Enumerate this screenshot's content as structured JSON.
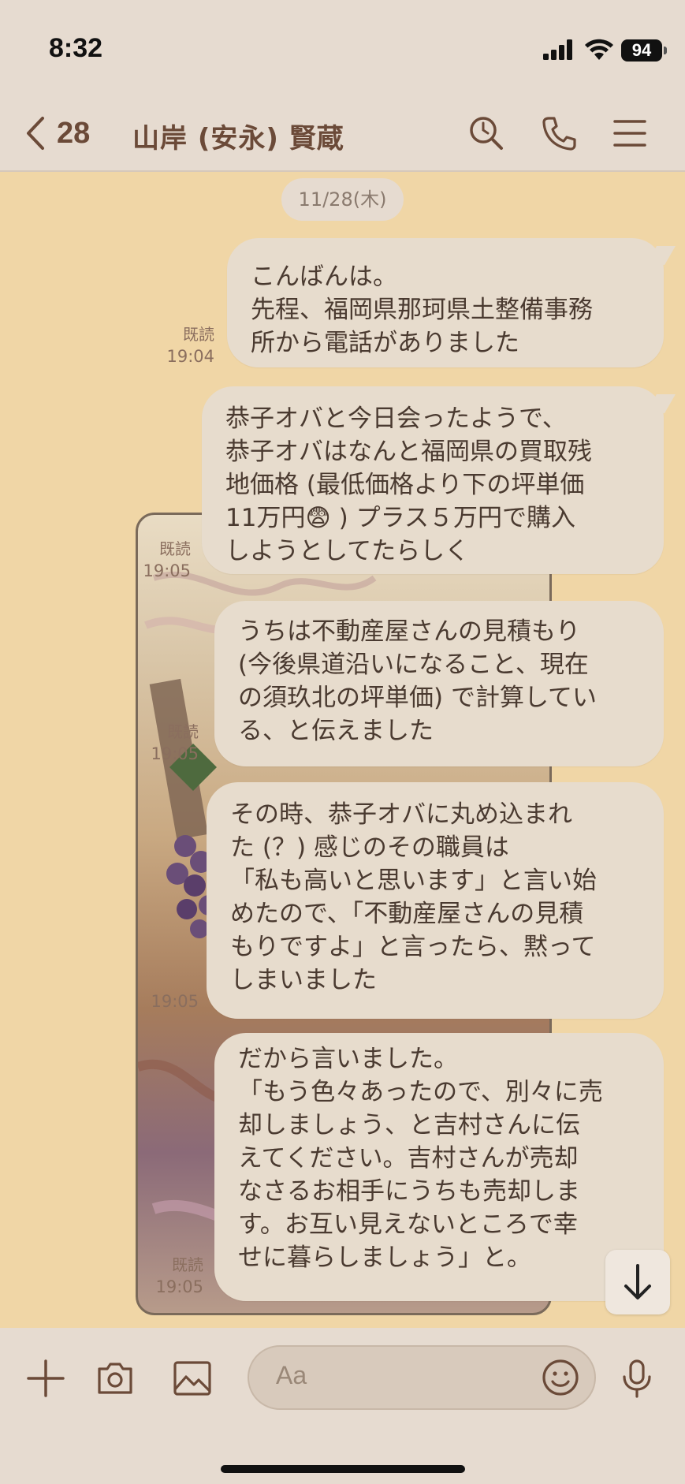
{
  "status_bar": {
    "time": "8:32",
    "battery": "94"
  },
  "header": {
    "back_count": "28",
    "title": "山岸 (安永) 賢蔵",
    "icons": [
      "search-icon",
      "phone-icon",
      "menu-icon"
    ]
  },
  "chat": {
    "date": "11/28(木)",
    "messages": [
      {
        "read": "既読",
        "time": "19:04",
        "lines": [
          "こんばんは。",
          "先程、福岡県那珂県土整備事務",
          "所から電話がありました"
        ]
      },
      {
        "read": "既読",
        "time": "19:05",
        "lines": [
          "恭子オバと今日会ったようで、",
          "恭子オバはなんと福岡県の買取残",
          "地価格 (最低価格より下の坪単価",
          "11万円😨 ) プラス５万円で購入",
          "しようとしてたらしく"
        ]
      },
      {
        "read": "既読",
        "time": "19:05",
        "lines": [
          "うちは不動産屋さんの見積もり",
          "(今後県道沿いになること、現在",
          "の須玖北の坪単価) で計算してい",
          "る、と伝えました"
        ]
      },
      {
        "read": "",
        "time": "19:05",
        "lines": [
          "その時、恭子オバに丸め込まれ",
          "た (？) 感じのその職員は",
          "「私も高いと思います」と言い始",
          "めたので、「不動産屋さんの見積",
          "もりですよ」と言ったら、黙って",
          "しまいました"
        ]
      },
      {
        "read": "既読",
        "time": "19:05",
        "lines": [
          "だから言いました。",
          "「もう色々あったので、別々に売",
          "却しましょう、と吉村さんに伝",
          "えてください。吉村さんが売却",
          "なさるお相手にうちも売却しま",
          "す。お互い見えないところで幸",
          "せに暮らしましょう」と。"
        ]
      }
    ]
  },
  "input": {
    "placeholder": "Aa"
  },
  "colors": {
    "chat_bg": "#f0d6a6",
    "bubble": "#e7dccd",
    "header_bg": "#e6dbd0",
    "accent": "#6b4a38"
  }
}
